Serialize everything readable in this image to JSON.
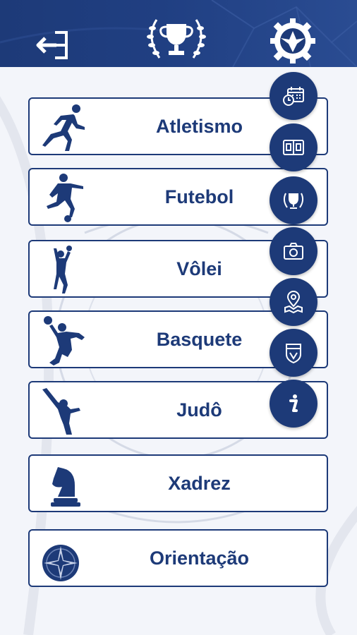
{
  "colors": {
    "primary": "#1d3a78",
    "card_bg": "#ffffff",
    "page_bg": "#f3f5fa"
  },
  "header": {
    "back_icon": "logout-arrow-icon",
    "center_icon": "trophy-laurel-icon",
    "right_icon": "gear-crest-icon"
  },
  "sports": [
    {
      "label": "Atletismo",
      "icon": "runner-icon"
    },
    {
      "label": "Futebol",
      "icon": "soccer-player-icon"
    },
    {
      "label": "Vôlei",
      "icon": "volleyball-player-icon"
    },
    {
      "label": "Basquete",
      "icon": "basketball-player-icon"
    },
    {
      "label": "Judô",
      "icon": "martial-arts-icon"
    },
    {
      "label": "Xadrez",
      "icon": "chess-knight-icon"
    },
    {
      "label": "Orientação",
      "icon": "compass-rose-icon"
    }
  ],
  "fab_menu": [
    {
      "icon": "calendar-clock-icon"
    },
    {
      "icon": "scoreboard-icon"
    },
    {
      "icon": "trophy-icon"
    },
    {
      "icon": "camera-icon"
    },
    {
      "icon": "map-pin-icon"
    },
    {
      "icon": "shield-badge-icon"
    },
    {
      "icon": "info-icon"
    }
  ]
}
